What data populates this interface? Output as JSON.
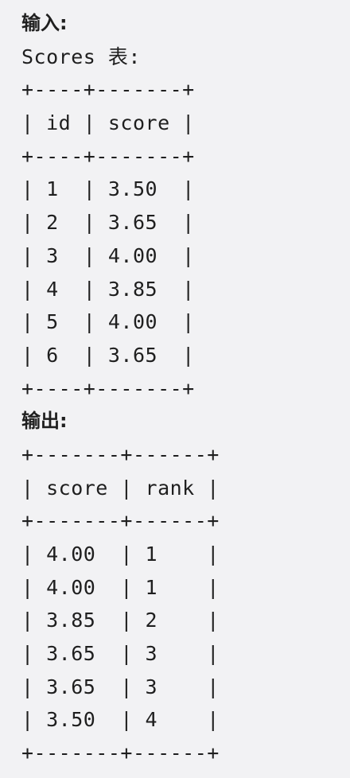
{
  "input_section": {
    "heading": "输入:",
    "table_caption": "Scores 表:",
    "table_lines": [
      "+----+-------+",
      "| id | score |",
      "+----+-------+",
      "| 1  | 3.50  |",
      "| 2  | 3.65  |",
      "| 3  | 4.00  |",
      "| 4  | 3.85  |",
      "| 5  | 4.00  |",
      "| 6  | 3.65  |",
      "+----+-------+"
    ]
  },
  "output_section": {
    "heading": "输出:",
    "table_lines": [
      "+-------+------+",
      "| score | rank |",
      "+-------+------+",
      "| 4.00  | 1    |",
      "| 4.00  | 1    |",
      "| 3.85  | 2    |",
      "| 3.65  | 3    |",
      "| 3.65  | 3    |",
      "| 3.50  | 4    |",
      "+-------+------+"
    ]
  }
}
